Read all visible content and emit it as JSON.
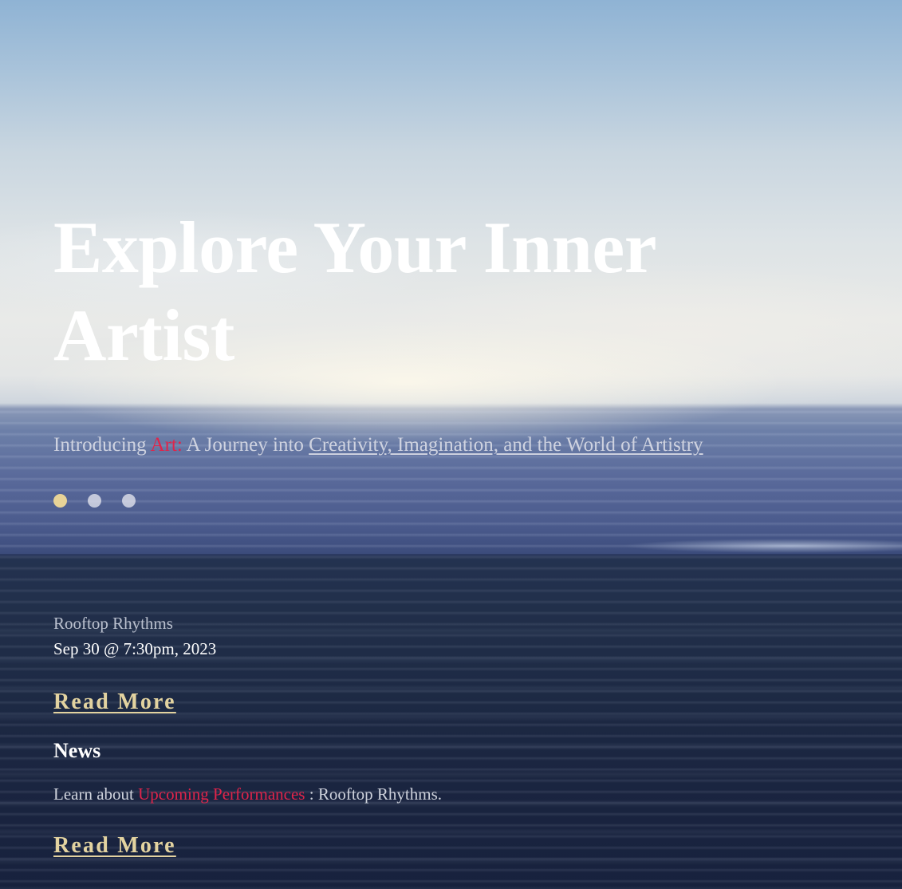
{
  "hero": {
    "title": "Explore Your Inner Artist",
    "subtitle_intro": "Introducing",
    "subtitle_accent": "Art:",
    "subtitle_middle": "A Journey into",
    "subtitle_link": "Creativity, Imagination, and the World of Artistry"
  },
  "carousel": {
    "slide_count": 3,
    "active_index": 0
  },
  "event": {
    "name": "Rooftop Rhythms",
    "date": "Sep 30 @ 7:30pm, 2023",
    "read_more_label": "Read More"
  },
  "news": {
    "heading": "News",
    "text_before": "Learn about",
    "text_accent": "Upcoming Performances",
    "text_after": ": Rooftop Rhythms.",
    "read_more_label": "Read More"
  },
  "colors": {
    "accent_red": "#e0244a",
    "accent_gold": "#e3d3a0",
    "active_dot": "#e8d397"
  }
}
